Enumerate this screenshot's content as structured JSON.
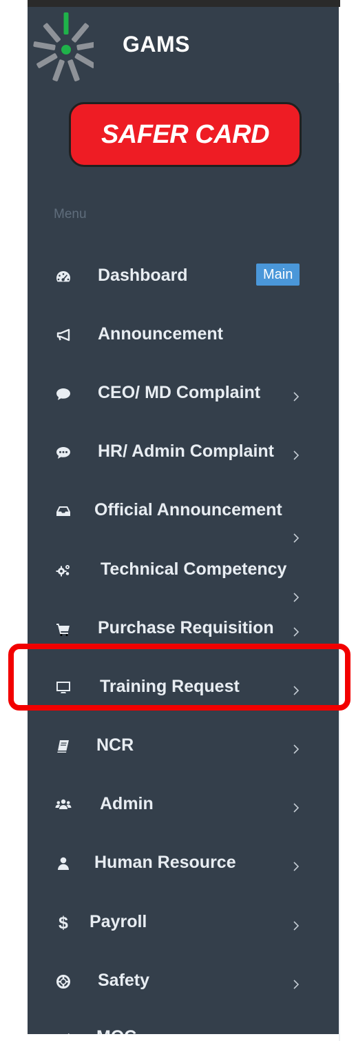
{
  "app": {
    "title": "GAMS"
  },
  "safer_card": {
    "label": "SAFER CARD"
  },
  "menu": {
    "heading": "Menu",
    "items": [
      {
        "label": "Dashboard",
        "badge": "Main",
        "icon": "dashboard-icon"
      },
      {
        "label": "Announcement",
        "icon": "bullhorn-icon"
      },
      {
        "label": "CEO/ MD Complaint",
        "icon": "comment-icon"
      },
      {
        "label": "HR/ Admin Complaint",
        "icon": "commenting-icon"
      },
      {
        "label": "Official Announcement",
        "icon": "inbox-icon"
      },
      {
        "label": "Technical Competency",
        "icon": "cogs-icon"
      },
      {
        "label": "Purchase Requisition",
        "icon": "shopping-cart-icon"
      },
      {
        "label": "Training Request",
        "icon": "desktop-icon"
      },
      {
        "label": "NCR",
        "icon": "book-icon"
      },
      {
        "label": "Admin",
        "icon": "users-icon"
      },
      {
        "label": "Human Resource",
        "icon": "user-icon"
      },
      {
        "label": "Payroll",
        "icon": "dollar-icon"
      },
      {
        "label": "Safety",
        "icon": "life-ring-icon"
      },
      {
        "label": "MOC",
        "icon": "check-icon"
      }
    ]
  },
  "colors": {
    "sidebar_bg": "#343f4b",
    "brand_red": "#ee1c24",
    "badge_blue": "#4a97d9",
    "highlight_red": "#f20000"
  }
}
